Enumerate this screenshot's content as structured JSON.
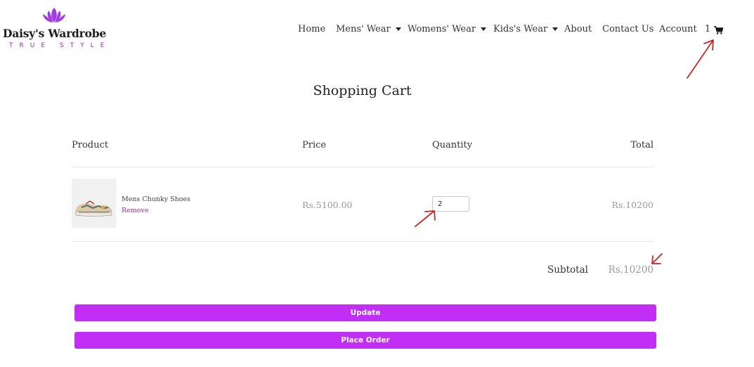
{
  "brand": {
    "name": "Daisy's Wardrobe",
    "tagline": "TRUE STYLE",
    "accent_color": "#c12ef6",
    "logo_color": "#a33ce0"
  },
  "nav": {
    "items": [
      {
        "label": "Home",
        "dropdown": false
      },
      {
        "label": "Mens' Wear",
        "dropdown": true
      },
      {
        "label": "Womens' Wear",
        "dropdown": true
      },
      {
        "label": "Kids's Wear",
        "dropdown": true
      },
      {
        "label": "About",
        "dropdown": false
      },
      {
        "label": "Contact Us",
        "dropdown": false
      },
      {
        "label": "Account",
        "dropdown": false
      }
    ],
    "cart_count": "1",
    "cart_icon": "shopping-cart-icon"
  },
  "page": {
    "title": "Shopping Cart"
  },
  "table": {
    "headers": {
      "product": "Product",
      "price": "Price",
      "quantity": "Quantity",
      "total": "Total"
    },
    "rows": [
      {
        "product_name": "Mens Chunky Shoes",
        "remove_label": "Remove",
        "price": "Rs.5100.00",
        "quantity": "2",
        "total": "Rs.10200"
      }
    ]
  },
  "summary": {
    "subtotal_label": "Subtotal",
    "subtotal_value": "Rs.10200"
  },
  "actions": {
    "update_label": "Update",
    "place_order_label": "Place Order"
  },
  "annotation_color": "#c62828"
}
